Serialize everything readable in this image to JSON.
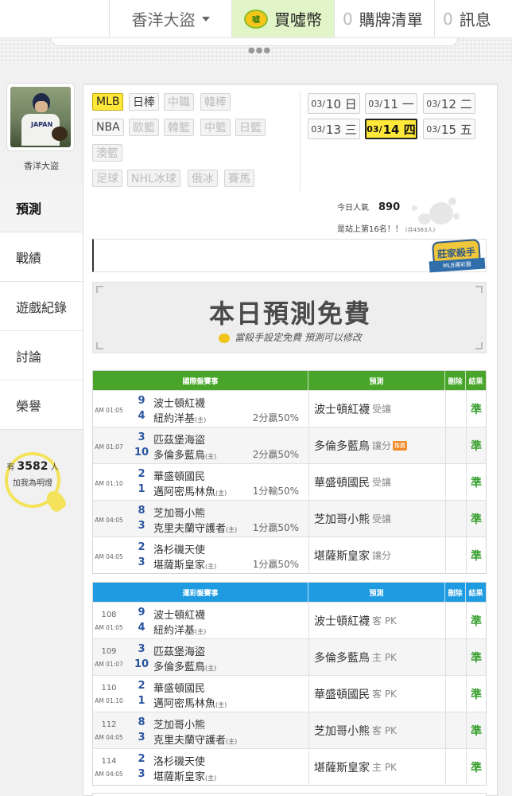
{
  "topbar": {
    "username": "香洋大盜",
    "coin_icon_text": "嘘",
    "buy_coin_label": "買噓幣",
    "cart_count": "0",
    "cart_label": "購牌清單",
    "msg_count": "0",
    "msg_label": "訊息",
    "page_dots": "●●●"
  },
  "profile": {
    "name": "香洋大盜",
    "jersey_text": "JAPAN"
  },
  "sidenav": [
    {
      "label": "預測"
    },
    {
      "label": "戰績"
    },
    {
      "label": "遊戲紀錄"
    },
    {
      "label": "討論"
    },
    {
      "label": "榮譽"
    }
  ],
  "fans": {
    "prefix": "有",
    "count": "3582",
    "suffix": "人",
    "caption": "加我為明燈"
  },
  "leagues": {
    "row1": [
      "MLB",
      "日棒",
      "中職",
      "韓棒"
    ],
    "row2": [
      "NBA",
      "歐籃",
      "韓籃",
      "中籃",
      "日籃"
    ],
    "row3": [
      "澳籃"
    ],
    "row4": [
      "足球",
      "NHL冰球",
      "俄冰",
      "賽馬"
    ]
  },
  "dates": [
    {
      "month": "03/",
      "day": "10 日"
    },
    {
      "month": "03/",
      "day": "11 一"
    },
    {
      "month": "03/",
      "day": "12 二"
    },
    {
      "month": "03/",
      "day": "13 三"
    },
    {
      "month": "03/",
      "day": "14 四"
    },
    {
      "month": "03/",
      "day": "15 五"
    }
  ],
  "popularity": {
    "label": "今日人氣",
    "value": "890",
    "rank_text": "是站上第16名！！",
    "rank_note": "(共4583人)"
  },
  "badge": {
    "title": "莊家殺手",
    "ribbon": "MLB運彩盤"
  },
  "banner": {
    "title": "本日預測免費",
    "subtitle": "當殺手設定免費  預測可以修改"
  },
  "intl_table": {
    "headers": {
      "match": "國際盤賽事",
      "pred": "預測",
      "del": "刪除",
      "res": "結果"
    },
    "rows": [
      {
        "time": "AM 01:05",
        "s1": "9",
        "t1": "波士頓紅襪",
        "s2": "4",
        "t2": "紐約洋基",
        "home": "(主)",
        "odds": "2分贏50%",
        "pick": "波士頓紅襪",
        "ptype": "受讓",
        "tag": "",
        "result": "準"
      },
      {
        "time": "AM 01:07",
        "s1": "3",
        "t1": "匹茲堡海盜",
        "s2": "10",
        "t2": "多倫多藍鳥",
        "home": "(主)",
        "odds": "2分贏50%",
        "pick": "多倫多藍鳥",
        "ptype": "讓分",
        "tag": "推薦",
        "result": "準"
      },
      {
        "time": "AM 01:10",
        "s1": "2",
        "t1": "華盛頓國民",
        "s2": "1",
        "t2": "邁阿密馬林魚",
        "home": "(主)",
        "odds": "1分輸50%",
        "pick": "華盛頓國民",
        "ptype": "受讓",
        "tag": "",
        "result": "準"
      },
      {
        "time": "AM 04:05",
        "s1": "8",
        "t1": "芝加哥小熊",
        "s2": "3",
        "t2": "克里夫蘭守護者",
        "home": "(主)",
        "odds": "1分贏50%",
        "pick": "芝加哥小熊",
        "ptype": "受讓",
        "tag": "",
        "result": "準"
      },
      {
        "time": "AM 04:05",
        "s1": "2",
        "t1": "洛杉磯天使",
        "s2": "3",
        "t2": "堪薩斯皇家",
        "home": "(主)",
        "odds": "1分贏50%",
        "pick": "堪薩斯皇家",
        "ptype": "讓分",
        "tag": "",
        "result": "準"
      }
    ]
  },
  "lottery_table": {
    "headers": {
      "match": "運彩盤賽事",
      "pred": "預測",
      "del": "刪除",
      "res": "結果"
    },
    "rows": [
      {
        "num": "108",
        "time": "AM 01:05",
        "s1": "9",
        "t1": "波士頓紅襪",
        "s2": "4",
        "t2": "紐約洋基",
        "home": "(主)",
        "pick": "波士頓紅襪",
        "ptype": "客 PK",
        "result": "準"
      },
      {
        "num": "109",
        "time": "AM 01:07",
        "s1": "3",
        "t1": "匹茲堡海盜",
        "s2": "10",
        "t2": "多倫多藍鳥",
        "home": "(主)",
        "pick": "多倫多藍鳥",
        "ptype": "主 PK",
        "result": "準"
      },
      {
        "num": "110",
        "time": "AM 01:10",
        "s1": "2",
        "t1": "華盛頓國民",
        "s2": "1",
        "t2": "邁阿密馬林魚",
        "home": "(主)",
        "pick": "華盛頓國民",
        "ptype": "客 PK",
        "result": "準"
      },
      {
        "num": "112",
        "time": "AM 04:05",
        "s1": "8",
        "t1": "芝加哥小熊",
        "s2": "3",
        "t2": "克里夫蘭守護者",
        "home": "(主)",
        "pick": "芝加哥小熊",
        "ptype": "客 PK",
        "result": "準"
      },
      {
        "num": "114",
        "time": "AM 04:05",
        "s1": "2",
        "t1": "洛杉磯天使",
        "s2": "3",
        "t2": "堪薩斯皇家",
        "home": "(主)",
        "pick": "堪薩斯皇家",
        "ptype": "主 PK",
        "result": "準"
      }
    ]
  },
  "colors": {
    "accent_yellow": "#ffe83a",
    "intl_header": "#48a52a",
    "lottery_header": "#1f9be2",
    "win_green": "#3aa031"
  }
}
